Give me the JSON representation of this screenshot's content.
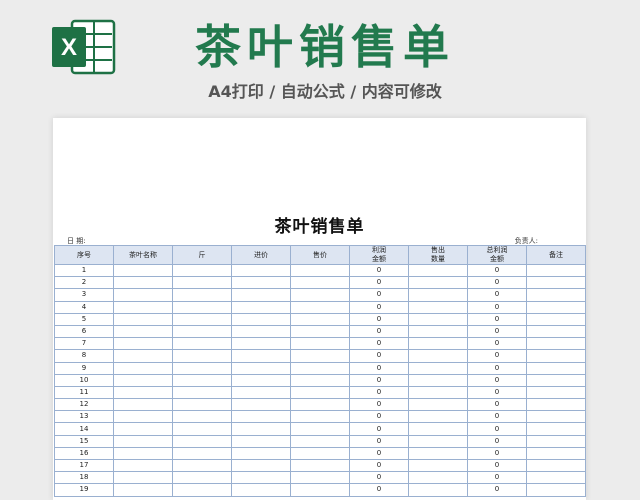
{
  "banner": {
    "title": "茶叶销售单",
    "subtitle": "A4打印 / 自动公式 / 内容可修改",
    "logo_letter": "X",
    "logo_color": "#1e7145"
  },
  "sheet": {
    "title": "茶叶销售单",
    "date_label": "日  期:",
    "owner_label": "负责人:",
    "columns": [
      {
        "label": "序号"
      },
      {
        "label": "茶叶名称"
      },
      {
        "label": "斤"
      },
      {
        "label": "进价"
      },
      {
        "label": "售价"
      },
      {
        "line1": "利润",
        "line2": "金额"
      },
      {
        "line1": "售出",
        "line2": "数量"
      },
      {
        "line1": "总利润",
        "line2": "金额"
      },
      {
        "label": "备注"
      }
    ],
    "rows": [
      {
        "no": "1",
        "profit": "0",
        "total": "0"
      },
      {
        "no": "2",
        "profit": "0",
        "total": "0"
      },
      {
        "no": "3",
        "profit": "0",
        "total": "0"
      },
      {
        "no": "4",
        "profit": "0",
        "total": "0"
      },
      {
        "no": "5",
        "profit": "0",
        "total": "0"
      },
      {
        "no": "6",
        "profit": "0",
        "total": "0"
      },
      {
        "no": "7",
        "profit": "0",
        "total": "0"
      },
      {
        "no": "8",
        "profit": "0",
        "total": "0"
      },
      {
        "no": "9",
        "profit": "0",
        "total": "0"
      },
      {
        "no": "10",
        "profit": "0",
        "total": "0"
      },
      {
        "no": "11",
        "profit": "0",
        "total": "0"
      },
      {
        "no": "12",
        "profit": "0",
        "total": "0"
      },
      {
        "no": "13",
        "profit": "0",
        "total": "0"
      },
      {
        "no": "14",
        "profit": "0",
        "total": "0"
      },
      {
        "no": "15",
        "profit": "0",
        "total": "0"
      },
      {
        "no": "16",
        "profit": "0",
        "total": "0"
      },
      {
        "no": "17",
        "profit": "0",
        "total": "0"
      },
      {
        "no": "18",
        "profit": "0",
        "total": "0"
      },
      {
        "no": "19",
        "profit": "0",
        "total": "0"
      }
    ]
  }
}
